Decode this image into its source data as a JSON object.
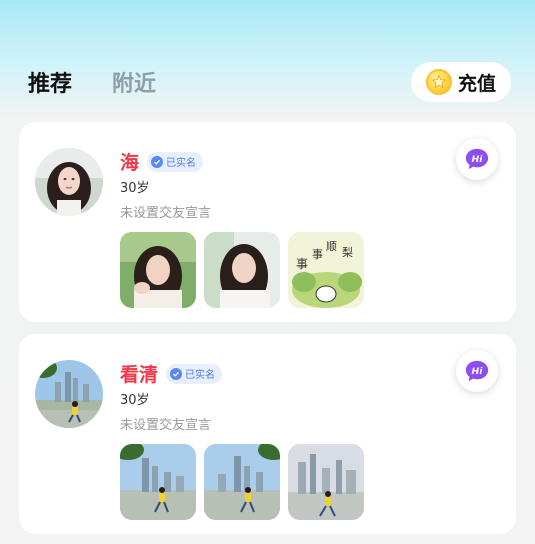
{
  "tabs": [
    {
      "label": "推荐",
      "active": true
    },
    {
      "label": "附近",
      "active": false
    }
  ],
  "recharge": {
    "label": "充值",
    "icon": "coin-icon"
  },
  "users": [
    {
      "name": "海",
      "verified_label": "已实名",
      "age": "30岁",
      "motto": "未设置交友宣言",
      "hi_label": "Hi",
      "photos": [
        "portrait-photo",
        "portrait-photo",
        "cartoon-sticker-photo"
      ]
    },
    {
      "name": "看清",
      "verified_label": "已实名",
      "age": "30岁",
      "motto": "未设置交友宣言",
      "hi_label": "Hi",
      "photos": [
        "city-skyline-photo",
        "city-skyline-photo",
        "city-skyline-photo"
      ]
    }
  ],
  "colors": {
    "name": "#f0384b",
    "verified": "#4d7cf5",
    "hi_bubble": "#8e4df2",
    "inactive_tab": "#8e9fa7"
  }
}
